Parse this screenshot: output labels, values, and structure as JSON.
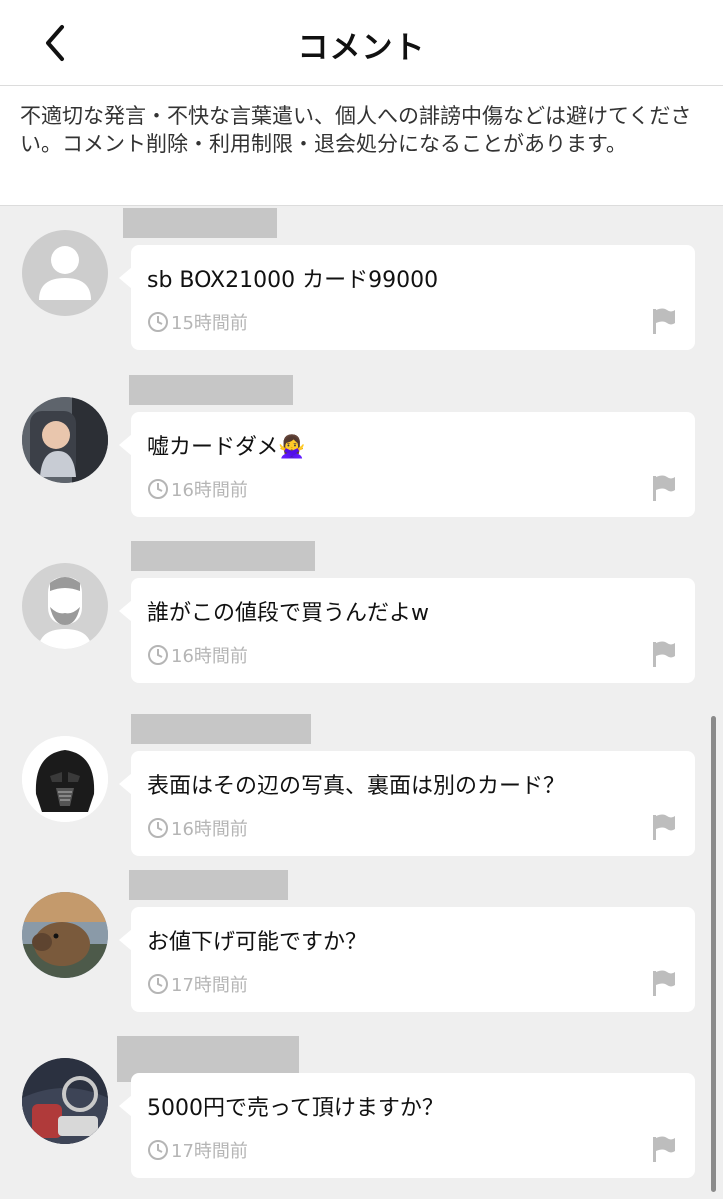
{
  "header": {
    "title": "コメント",
    "back_icon": "chevron-left-icon"
  },
  "notice": {
    "text": "不適切な発言・不快な言葉遣い、個人への誹謗中傷などは避けてください。コメント削除・利用制限・退会処分になることがあります。"
  },
  "comments": [
    {
      "text": "sb BOX21000 カード99000",
      "time": "15時間前",
      "avatar": "default-person-avatar"
    },
    {
      "text": "嘘カードダメ🙅‍♀️",
      "time": "16時間前",
      "avatar": "baby-photo-avatar"
    },
    {
      "text": "誰がこの値段で買うんだよw",
      "time": "16時間前",
      "avatar": "bearded-man-avatar"
    },
    {
      "text": "表面はその辺の写真、裏面は別のカード？",
      "time": "16時間前",
      "avatar": "darth-vader-avatar"
    },
    {
      "text": "お値下げ可能ですか？",
      "time": "17時間前",
      "avatar": "capybara-avatar"
    },
    {
      "text": "5000円で売って頂けますか？",
      "time": "17時間前",
      "avatar": "car-interior-avatar"
    }
  ],
  "colors": {
    "background": "#efefef",
    "bubble": "#ffffff",
    "timestamp": "#b5b5b5",
    "redaction": "#c6c6c6"
  }
}
